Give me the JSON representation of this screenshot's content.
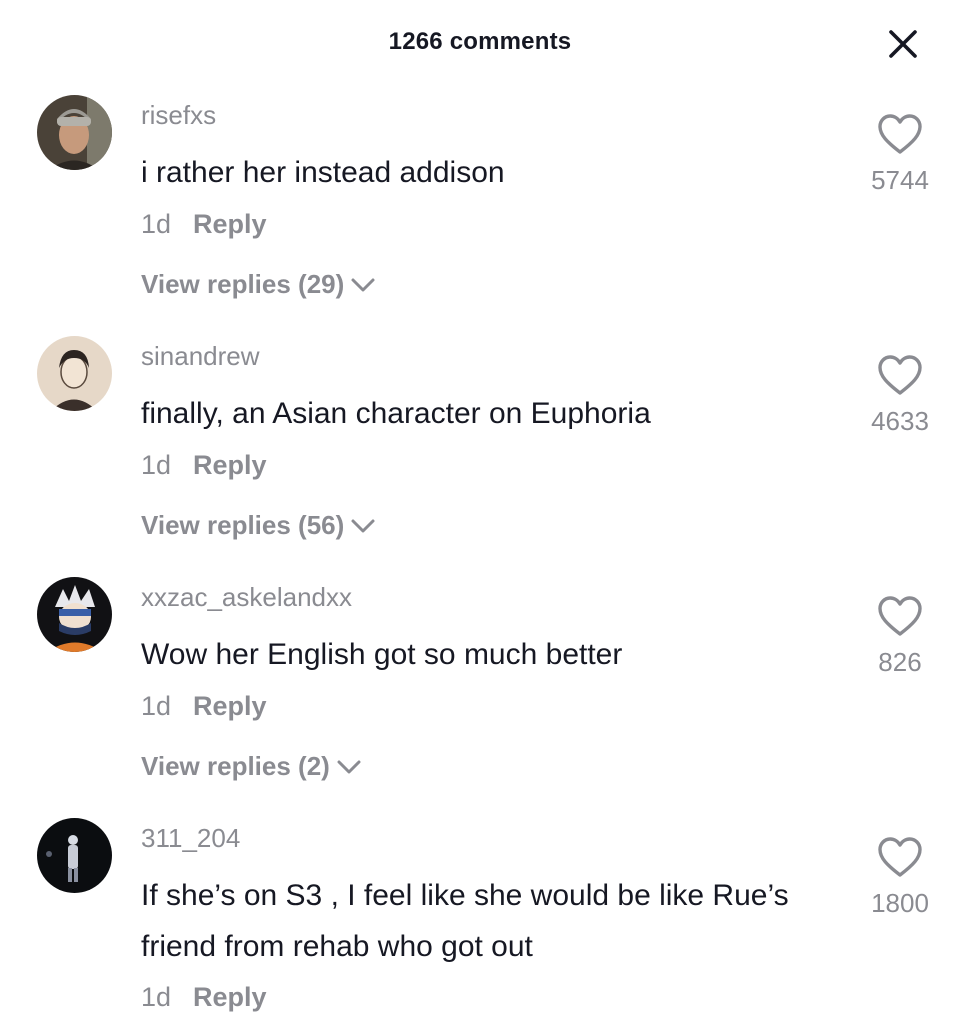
{
  "header": {
    "title": "1266 comments",
    "close_icon": "close-icon"
  },
  "comments": [
    {
      "username": "risefxs",
      "text": "i rather her instead addison",
      "time": "1d",
      "reply_label": "Reply",
      "view_replies": "View replies (29)",
      "likes": "5744"
    },
    {
      "username": "sinandrew",
      "text": "finally, an Asian character on Euphoria",
      "time": "1d",
      "reply_label": "Reply",
      "view_replies": "View replies (56)",
      "likes": "4633"
    },
    {
      "username": "xxzac_askelandxx",
      "text": "Wow her English got so much better",
      "time": "1d",
      "reply_label": "Reply",
      "view_replies": "View replies (2)",
      "likes": "826"
    },
    {
      "username": "311_204",
      "text": "If she’s on S3 , I feel like she would be like Rue’s friend from rehab who got out",
      "time": "1d",
      "reply_label": "Reply",
      "likes": "1800"
    }
  ],
  "icons": {
    "like": "heart-outline-icon",
    "expand": "chevron-down-icon"
  },
  "colors": {
    "text_primary": "#161823",
    "text_secondary": "#8a8b91",
    "background": "#ffffff"
  }
}
